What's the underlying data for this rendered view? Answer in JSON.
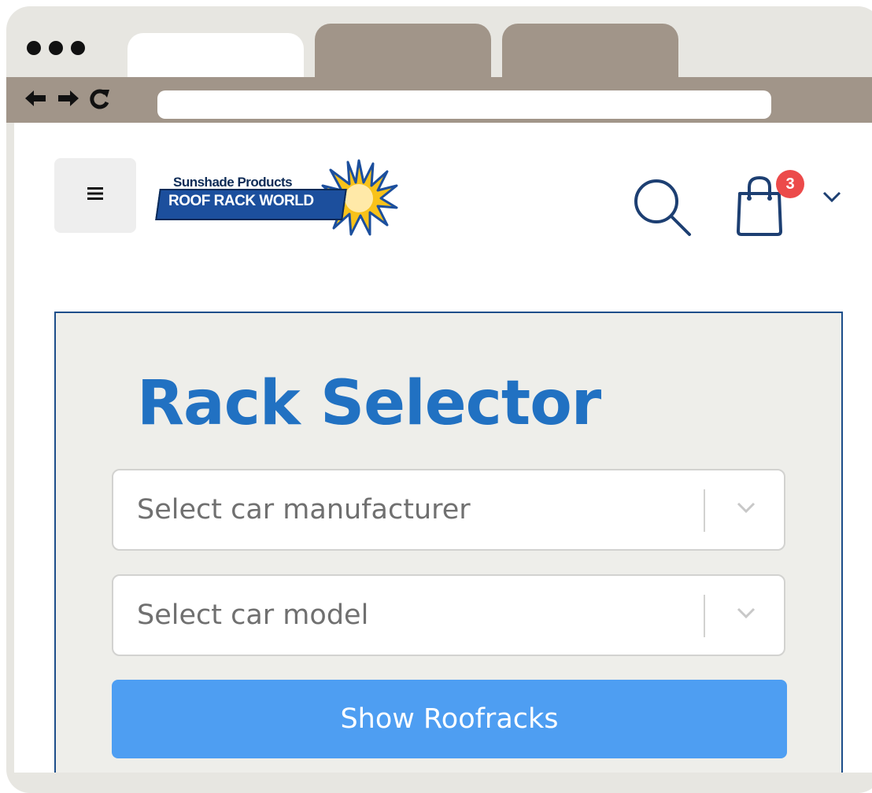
{
  "browser": {
    "tabs": [
      "",
      "",
      ""
    ],
    "url": ""
  },
  "header": {
    "logo": {
      "line1": "Sunshade Products",
      "line2": "ROOF RACK WORLD"
    },
    "cart_count": "3"
  },
  "selector": {
    "title": "Rack Selector",
    "manufacturer_placeholder": "Select car manufacturer",
    "model_placeholder": "Select car model",
    "submit_label": "Show Roofracks"
  },
  "colors": {
    "accent": "#2171c2",
    "button": "#4e9ef2",
    "badge": "#ec4a4a",
    "panel_bg": "#eeeeea",
    "browser_chrome": "#a19589"
  },
  "icons": [
    "menu-icon",
    "search-icon",
    "shopping-bag-icon",
    "chevron-down-icon",
    "back-arrow-icon",
    "forward-arrow-icon",
    "reload-icon"
  ]
}
